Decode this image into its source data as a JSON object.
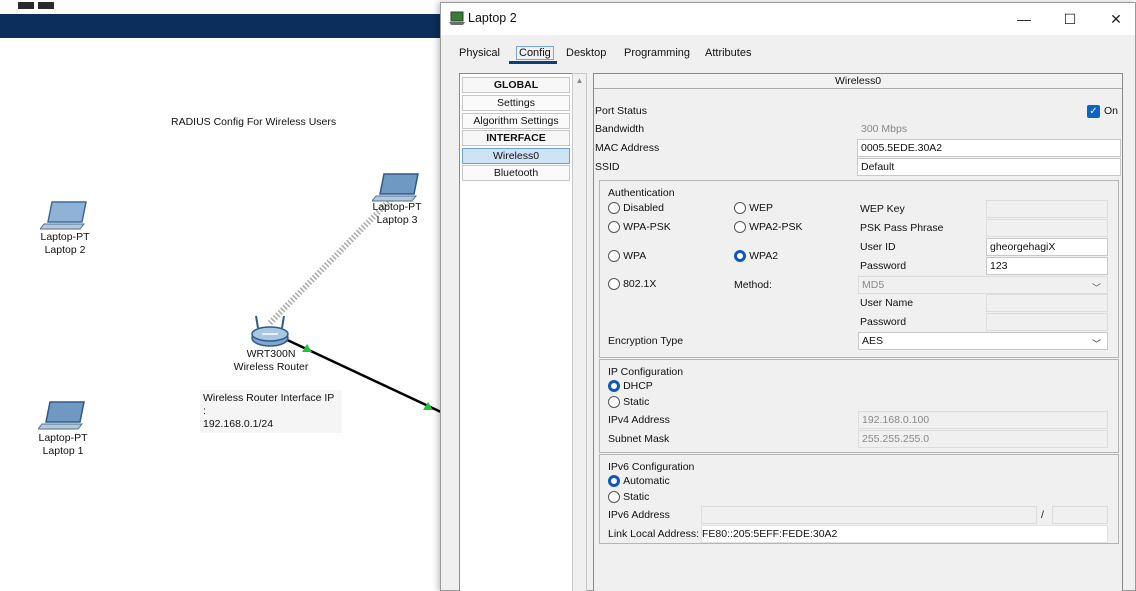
{
  "workspace": {
    "caption": "RADIUS Config For Wireless Users",
    "laptop2": {
      "model": "Laptop-PT",
      "name": "Laptop 2"
    },
    "laptop3": {
      "model": "Laptop-PT",
      "name": "Laptop 3"
    },
    "laptop1": {
      "model": "Laptop-PT",
      "name": "Laptop 1"
    },
    "router": {
      "model": "WRT300N",
      "name": "Wireless Router"
    },
    "router_note_line1": "Wireless Router Interface IP :",
    "router_note_line2": "192.168.0.1/24"
  },
  "dialog": {
    "title": "Laptop 2",
    "window_buttons": {
      "minimize": "—",
      "maximize": "☐",
      "close": "✕"
    },
    "tabs": [
      "Physical",
      "Config",
      "Desktop",
      "Programming",
      "Attributes"
    ],
    "active_tab": "Config",
    "sidebar": {
      "global_header": "GLOBAL",
      "items_global": [
        "Settings",
        "Algorithm Settings"
      ],
      "interface_header": "INTERFACE",
      "items_interface": [
        "Wireless0",
        "Bluetooth"
      ],
      "selected": "Wireless0"
    },
    "wireless": {
      "header": "Wireless0",
      "port_status_label": "Port Status",
      "port_status_value": "On",
      "bandwidth_label": "Bandwidth",
      "bandwidth_value": "300 Mbps",
      "mac_label": "MAC Address",
      "mac_value": "0005.5EDE.30A2",
      "ssid_label": "SSID",
      "ssid_value": "Default",
      "auth": {
        "title": "Authentication",
        "opt_disabled": "Disabled",
        "opt_wep": "WEP",
        "opt_wpapsk": "WPA-PSK",
        "opt_wpa2psk": "WPA2-PSK",
        "opt_wpa": "WPA",
        "opt_wpa2": "WPA2",
        "opt_8021x": "802.1X",
        "selected": "WPA2",
        "wep_key_label": "WEP Key",
        "psk_label": "PSK Pass Phrase",
        "userid_label": "User ID",
        "userid_value": "gheorgehagiX",
        "password_label": "Password",
        "password_value": "123",
        "method_label": "Method:",
        "method_value": "MD5",
        "username_label": "User Name",
        "password2_label": "Password",
        "enc_label": "Encryption Type",
        "enc_value": "AES"
      },
      "ip": {
        "title": "IP Configuration",
        "opt_dhcp": "DHCP",
        "opt_static": "Static",
        "selected": "DHCP",
        "ipv4_label": "IPv4 Address",
        "ipv4_value": "192.168.0.100",
        "mask_label": "Subnet Mask",
        "mask_value": "255.255.255.0"
      },
      "ipv6": {
        "title": "IPv6 Configuration",
        "opt_auto": "Automatic",
        "opt_static": "Static",
        "selected": "Automatic",
        "addr_label": "IPv6 Address",
        "slash": "/",
        "link_local_label": "Link Local Address:",
        "link_local_value": "FE80::205:5EFF:FEDE:30A2"
      }
    }
  }
}
